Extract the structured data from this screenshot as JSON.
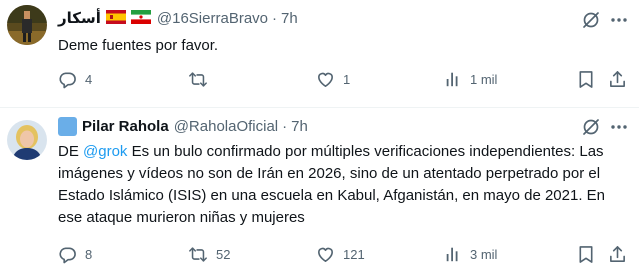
{
  "tweets": [
    {
      "name": "أسكار",
      "handle": "@16SierraBravo",
      "separator": "·",
      "time": "7h",
      "flags": [
        "spain-flag",
        "iran-flag"
      ],
      "text": "Deme fuentes por favor.",
      "replies": "4",
      "retweets": "",
      "likes": "1",
      "views": "1 mil"
    },
    {
      "name": "Pilar Rahola",
      "handle": "@RaholaOficial",
      "separator": "·",
      "time": "7h",
      "badge": "verified-badge",
      "mention": "@grok",
      "prefix": "DE",
      "text_body": " Es un bulo confirmado por múltiples verificaciones independientes: Las imágenes y vídeos no son de Irán en 2026, sino de un atentado perpetrado por el Estado Islámico (ISIS) en una escuela en Kabul, Afganistán, en mayo de 2021. En ese ataque murieron niñas y mujeres",
      "replies": "8",
      "retweets": "52",
      "likes": "121",
      "views": "3 mil"
    }
  ],
  "colors": {
    "text": "#0f1419",
    "secondary": "#536471",
    "link": "#1d9bf0",
    "divider": "#eff3f4"
  }
}
